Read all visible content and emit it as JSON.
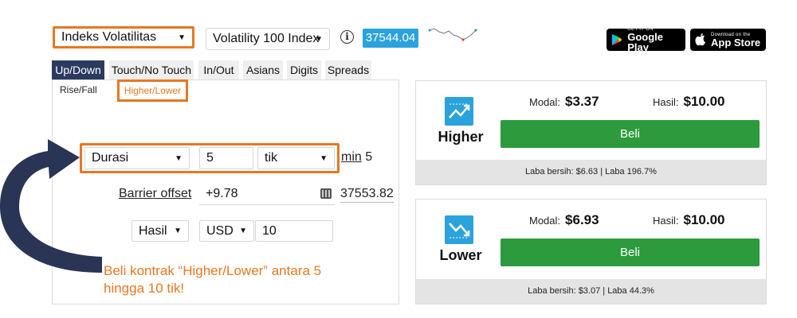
{
  "top": {
    "market_select": "Indeks Volatilitas",
    "index_select": "Volatility 100 Index",
    "price": "37544.04",
    "google_play_small": "GET IT ON",
    "google_play_big": "Google Play",
    "app_store_small": "Download on the",
    "app_store_big": "App Store"
  },
  "tabs": [
    "Up/Down",
    "Touch/No Touch",
    "In/Out",
    "Asians",
    "Digits",
    "Spreads"
  ],
  "subtabs": [
    "Rise/Fall",
    "Higher/Lower"
  ],
  "form": {
    "duration_label": "Durasi",
    "duration_value": "5",
    "duration_unit": "tik",
    "min_label": "min",
    "min_value": "5",
    "barrier_label": "Barrier offset",
    "barrier_value": "+9.78",
    "barrier_result": "37553.82",
    "basis": "Hasil",
    "currency": "USD",
    "amount": "10"
  },
  "note": "Beli kontrak “Higher/Lower” antara 5 hingga 10 tik!",
  "higher": {
    "name": "Higher",
    "modal_label": "Modal:",
    "modal_value": "$3.37",
    "hasil_label": "Hasil:",
    "hasil_value": "$10.00",
    "buy": "Beli",
    "footer": "Laba bersih: $6.63 | Laba 196.7%"
  },
  "lower": {
    "name": "Lower",
    "modal_label": "Modal:",
    "modal_value": "$6.93",
    "hasil_label": "Hasil:",
    "hasil_value": "$10.00",
    "buy": "Beli",
    "footer": "Laba bersih: $3.07 | Laba 44.3%"
  },
  "colors": {
    "accent_orange": "#e87722",
    "tab_active": "#2b3a5e",
    "price_blue": "#2aa3dc",
    "buy_green": "#2e9a3e",
    "arrow_navy": "#2a3555"
  }
}
